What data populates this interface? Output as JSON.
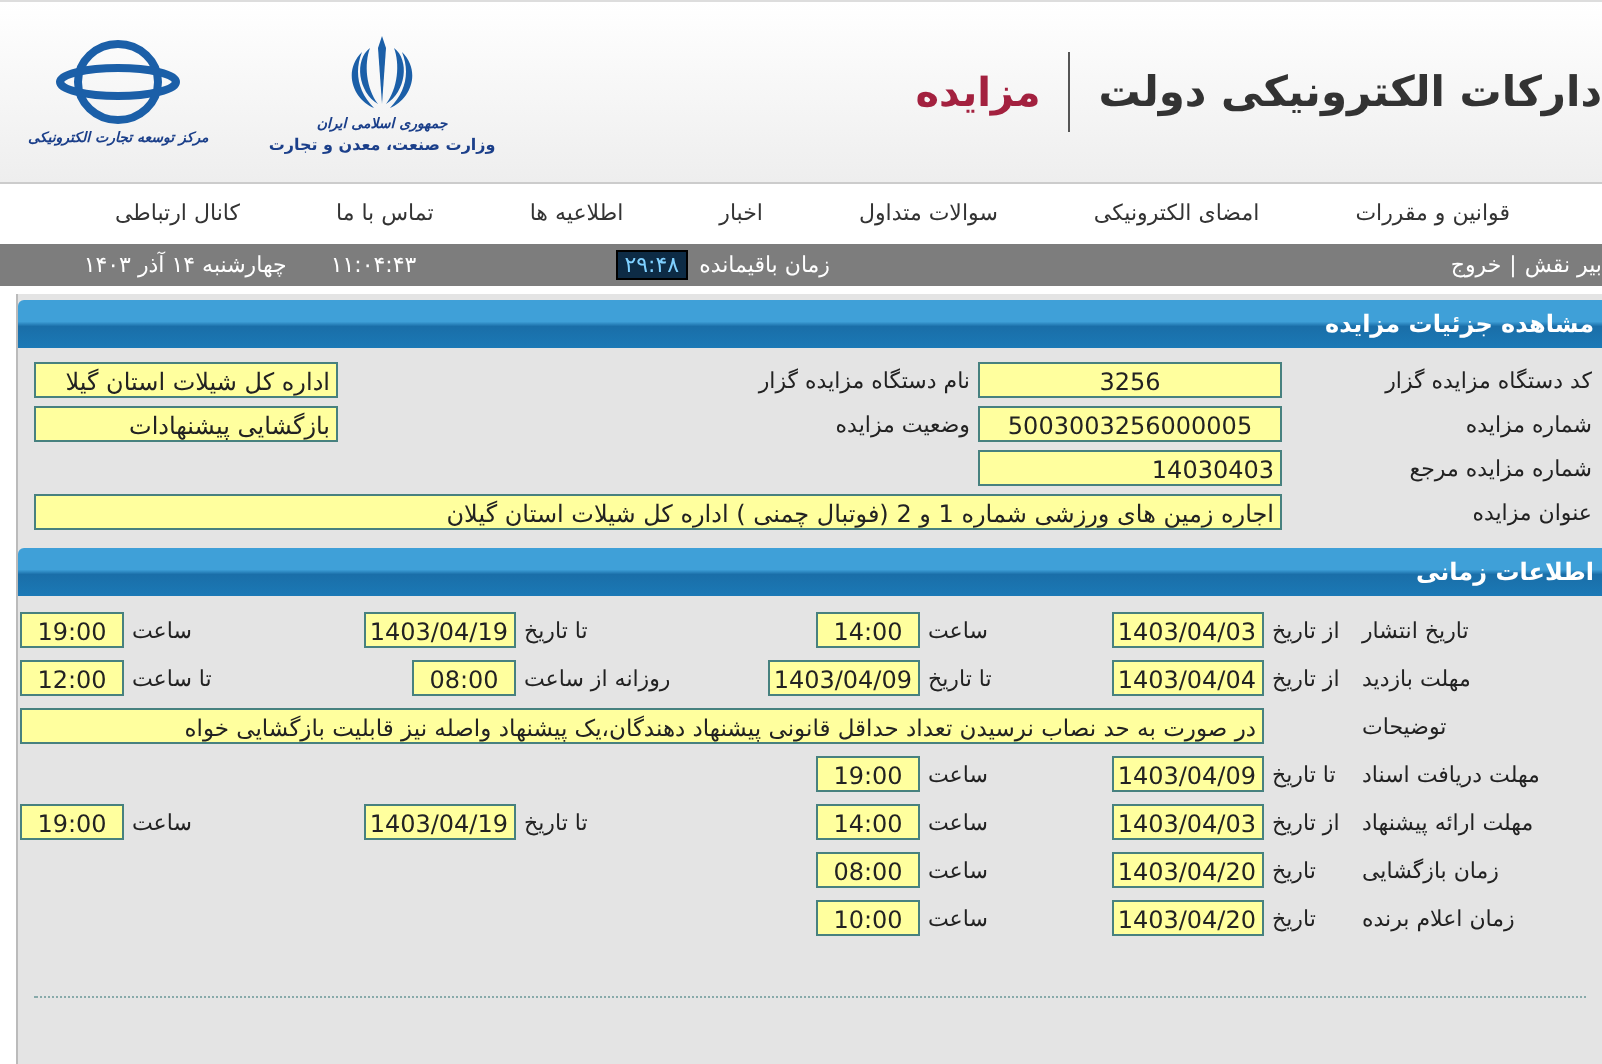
{
  "header": {
    "title": "دارکات الکترونیکی دولت",
    "section": "مزایده",
    "logos": [
      {
        "kind": "emblem",
        "lines": [
          "جمهوری اسلامی ایران",
          "وزارت صنعت، معدن و تجارت"
        ]
      },
      {
        "kind": "rings",
        "lines": [
          "مرکز توسعه تجارت الکترونیکی"
        ]
      }
    ]
  },
  "nav": [
    "قوانین و مقررات",
    "امضای الکترونیکی",
    "سوالات متداول",
    "اخبار",
    "اطلاعیه ها",
    "تماس با ما",
    "کانال ارتباطی"
  ],
  "status_bar": {
    "links": [
      "بیر نقش",
      "خروج"
    ],
    "separator": "|",
    "remaining_label": "زمان باقیمانده",
    "remaining_time": "۲۹:۴۸",
    "clock": "۱۱:۰۴:۴۳",
    "date": "چهارشنبه ۱۴ آذر ۱۴۰۳"
  },
  "details": {
    "title": "مشاهده جزئیات مزایده",
    "rows": [
      {
        "kind": "pair",
        "fields": [
          {
            "label": "کد دستگاه مزایده گزار",
            "value": "3256",
            "kind": "code"
          },
          {
            "label": "نام دستگاه مزایده گزار",
            "value": "اداره کل شیلات استان گیلا",
            "kind": "text"
          }
        ]
      },
      {
        "kind": "pair",
        "fields": [
          {
            "label": "شماره مزایده",
            "value": "5003003256000005",
            "kind": "code"
          },
          {
            "label": "وضعیت مزایده",
            "value": "بازگشایی پیشنهادات",
            "kind": "text"
          }
        ]
      },
      {
        "kind": "pair",
        "fields": [
          {
            "label": "شماره مزایده مرجع",
            "value": "14030403",
            "kind": "text"
          }
        ]
      },
      {
        "kind": "wide",
        "fields": [
          {
            "label": "عنوان مزایده",
            "value": "اجاره زمین های ورزشی  شماره 1 و 2 (فوتبال چمنی ) اداره کل شیلات استان گیلان",
            "kind": "text"
          }
        ]
      }
    ]
  },
  "timing": {
    "title": "اطلاعات زمانی",
    "rows": [
      {
        "kind": "slots",
        "label": "تاریخ انتشار",
        "pairs": [
          {
            "label": "از تاریخ",
            "value": "1403/04/03"
          },
          {
            "label": "ساعت",
            "value": "14:00"
          },
          {
            "label": "تا تاریخ",
            "value": "1403/04/19"
          },
          {
            "label": "ساعت",
            "value": "19:00"
          }
        ]
      },
      {
        "kind": "slots",
        "label": "مهلت بازدید",
        "pairs": [
          {
            "label": "از تاریخ",
            "value": "1403/04/04"
          },
          {
            "label": "تا تاریخ",
            "value": "1403/04/09"
          },
          {
            "label": "روزانه از ساعت",
            "value": "08:00"
          },
          {
            "label": "تا ساعت",
            "value": "12:00"
          }
        ]
      },
      {
        "kind": "note",
        "label": "توضیحات",
        "value": "در صورت به حد نصاب نرسیدن تعداد حداقل قانونی  پیشنهاد دهندگان،یک پیشنهاد واصله نیز قابلیت بازگشایی خواه"
      },
      {
        "kind": "slots",
        "label": "مهلت دریافت اسناد",
        "pairs": [
          {
            "label": "تا تاریخ",
            "value": "1403/04/09"
          },
          {
            "label": "ساعت",
            "value": "19:00"
          }
        ]
      },
      {
        "kind": "slots",
        "label": "مهلت ارائه پیشنهاد",
        "pairs": [
          {
            "label": "از تاریخ",
            "value": "1403/04/03"
          },
          {
            "label": "ساعت",
            "value": "14:00"
          },
          {
            "label": "تا تاریخ",
            "value": "1403/04/19"
          },
          {
            "label": "ساعت",
            "value": "19:00"
          }
        ]
      },
      {
        "kind": "slots",
        "label": "زمان بازگشایی",
        "pairs": [
          {
            "label": "تاریخ",
            "value": "1403/04/20"
          },
          {
            "label": "ساعت",
            "value": "08:00"
          }
        ]
      },
      {
        "kind": "slots",
        "label": "زمان اعلام برنده",
        "pairs": [
          {
            "label": "تاریخ",
            "value": "1403/04/20"
          },
          {
            "label": "ساعت",
            "value": "10:00"
          }
        ]
      }
    ]
  }
}
